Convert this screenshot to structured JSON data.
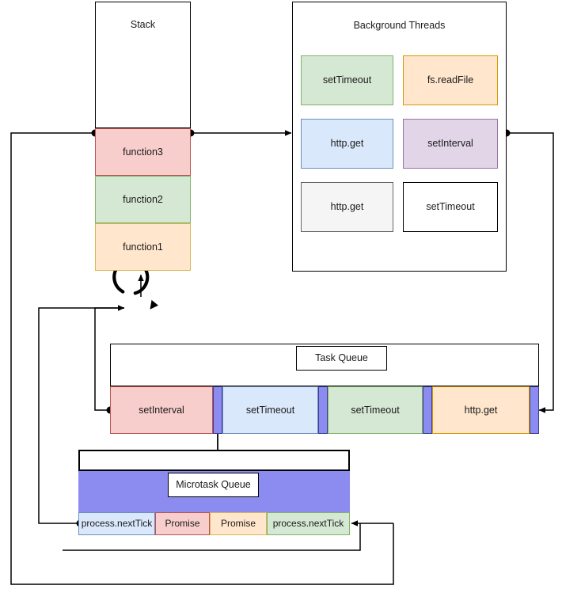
{
  "diagram": {
    "title_stack": "Stack",
    "title_background_threads": "Background Threads",
    "title_task_queue": "Task Queue",
    "title_microtask_queue": "Microtask Queue"
  },
  "stack": {
    "label": "Stack",
    "frames": [
      {
        "label": "function3",
        "fill": "#f8cecc",
        "stroke": "#b85450"
      },
      {
        "label": "function2",
        "fill": "#d5e8d4",
        "stroke": "#82b366"
      },
      {
        "label": "function1",
        "fill": "#ffe6cc",
        "stroke": "#d6b656"
      }
    ]
  },
  "background_threads": {
    "label": "Background Threads",
    "tasks": [
      {
        "label": "setTimeout",
        "fill": "#d5e8d4",
        "stroke": "#82b366"
      },
      {
        "label": "fs.readFile",
        "fill": "#ffe6cc",
        "stroke": "#d79b00"
      },
      {
        "label": "http.get",
        "fill": "#dae8fc",
        "stroke": "#6c8ebf"
      },
      {
        "label": "setInterval",
        "fill": "#e1d5e7",
        "stroke": "#9673a6"
      },
      {
        "label": "http.get",
        "fill": "#f5f5f5",
        "stroke": "#666666"
      },
      {
        "label": "setTimeout",
        "fill": "#ffffff",
        "stroke": "#000000"
      }
    ]
  },
  "task_queue": {
    "label": "Task Queue",
    "items": [
      {
        "label": "setInterval",
        "fill": "#f8cecc",
        "stroke": "#b85450"
      },
      {
        "label": "setTimeout",
        "fill": "#dae8fc",
        "stroke": "#6c8ebf"
      },
      {
        "label": "setTimeout",
        "fill": "#d5e8d4",
        "stroke": "#82b366"
      },
      {
        "label": "http.get",
        "fill": "#ffe6cc",
        "stroke": "#d79b00"
      }
    ],
    "separator_color": "#8c8cf0"
  },
  "microtask_queue": {
    "label": "Microtask Queue",
    "band_color": "#8c8cf0",
    "items": [
      {
        "label": "process.nextTick",
        "fill": "#dae8fc",
        "stroke": "#6c8ebf"
      },
      {
        "label": "Promise",
        "fill": "#f8cecc",
        "stroke": "#b85450"
      },
      {
        "label": "Promise",
        "fill": "#ffe6cc",
        "stroke": "#d6b656"
      },
      {
        "label": "process.nextTick",
        "fill": "#d5e8d4",
        "stroke": "#82b366"
      }
    ]
  },
  "event_loop": {
    "icon": "circular-arrow-icon"
  },
  "colors": {
    "line": "#000000",
    "text": "#1a1a1a"
  }
}
